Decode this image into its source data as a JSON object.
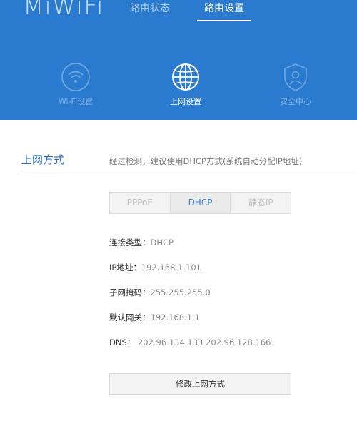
{
  "header": {
    "logo": "MiWiFi",
    "nav": [
      {
        "label": "路由状态"
      },
      {
        "label": "路由设置"
      }
    ],
    "subnav": [
      {
        "label": "Wi-Fi设置",
        "icon": "wifi-icon"
      },
      {
        "label": "上网设置",
        "icon": "globe-icon"
      },
      {
        "label": "安全中心",
        "icon": "shield-user-icon"
      }
    ],
    "active_nav": "路由设置",
    "active_subnav": "上网设置"
  },
  "main": {
    "section_title": "上网方式",
    "section_desc": "经过检测，建议使用DHCP方式(系统自动分配IP地址)",
    "tabs": [
      {
        "label": "PPPoE"
      },
      {
        "label": "DHCP"
      },
      {
        "label": "静态IP"
      }
    ],
    "active_tab": "DHCP",
    "info": [
      {
        "label": "连接类型：",
        "value": "DHCP"
      },
      {
        "label": "IP地址：",
        "value": "192.168.1.101"
      },
      {
        "label": "子网掩码：",
        "value": "255.255.255.0"
      },
      {
        "label": "默认网关：",
        "value": "192.168.1.1"
      },
      {
        "label": "DNS： ",
        "value": "202.96.134.133 202.96.128.166"
      }
    ],
    "modify_button": "修改上网方式"
  },
  "colors": {
    "header_bg": "#2a7bd0",
    "accent": "#2a6fbd"
  }
}
